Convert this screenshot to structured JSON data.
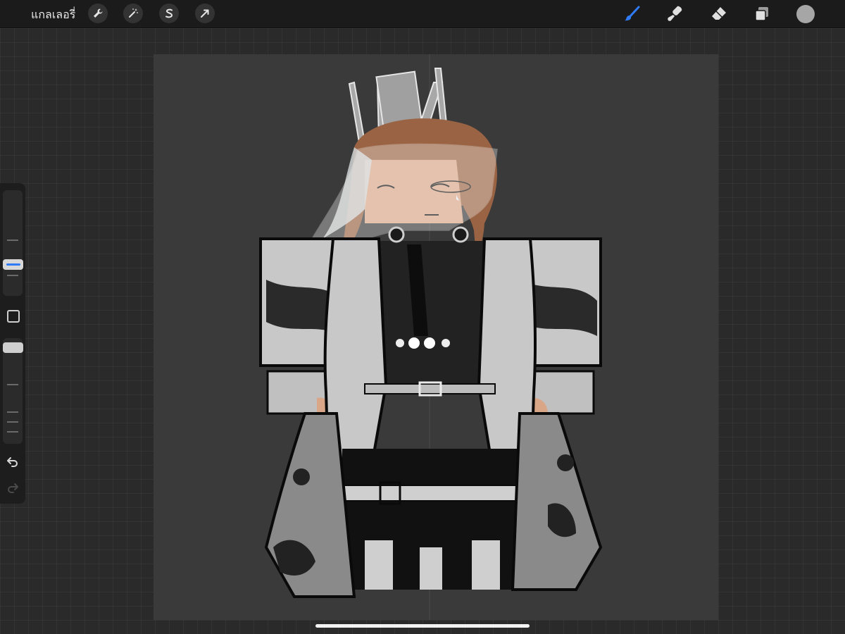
{
  "topbar": {
    "gallery_label": "แกลเลอรี่",
    "left_tools": [
      "wrench-icon",
      "magic-wand-icon",
      "selection-icon",
      "transform-arrow-icon"
    ],
    "right_tools": [
      "brush-icon",
      "smudge-icon",
      "eraser-icon",
      "layers-icon"
    ],
    "active_tool": "brush-icon",
    "active_color": "#a6a6a6",
    "accent": "#2f7cf6"
  },
  "sidebar": {
    "brush_size_level": 0.35,
    "opacity_level": 0.9,
    "modify_icon": "square-icon",
    "undo_icon": "undo-arrow-icon",
    "redo_icon": "redo-arrow-icon"
  },
  "canvas": {
    "background": "#3a3a3a",
    "artwork": "character-illustration"
  }
}
